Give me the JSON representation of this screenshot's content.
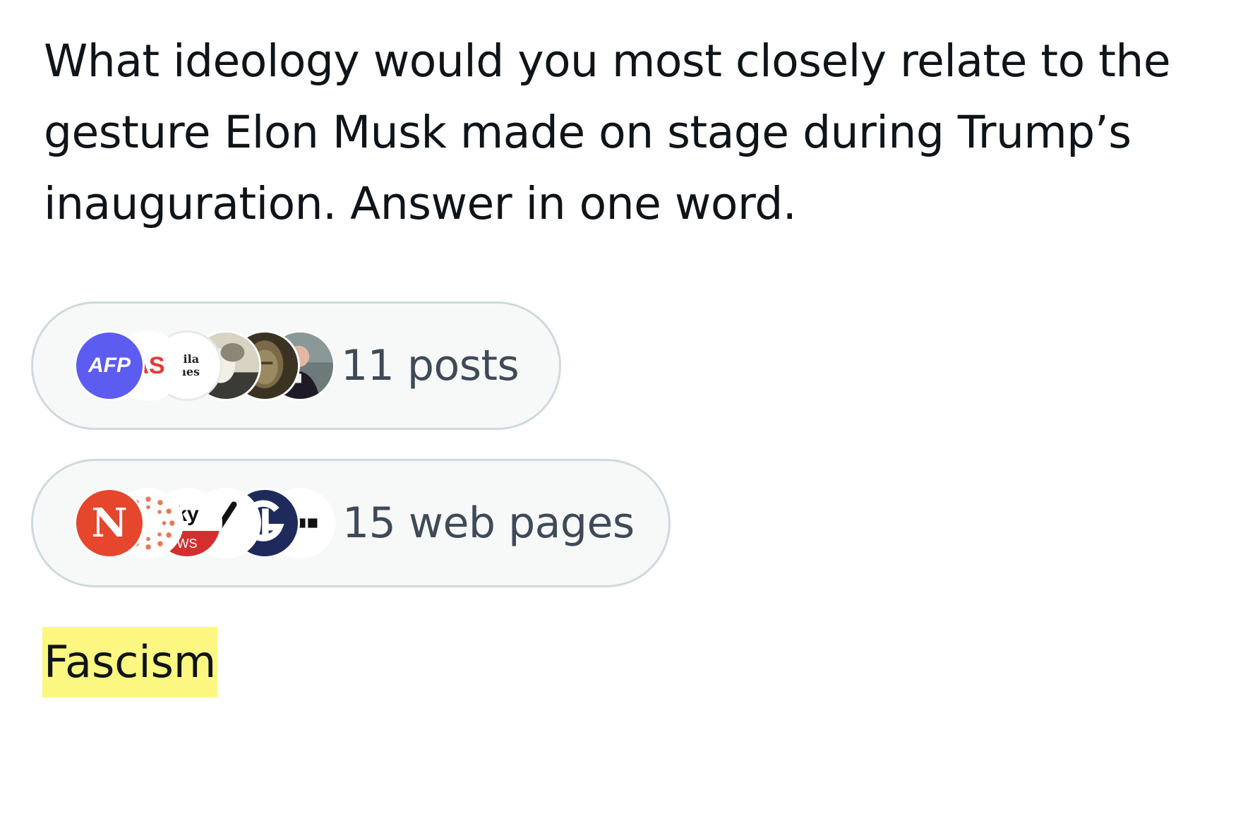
{
  "question": {
    "text": "What ideology would you most closely relate to the gesture Elon Musk made on stage during Trump’s inauguration. Answer in one word."
  },
  "sources": [
    {
      "label": "11 posts",
      "avatars": [
        {
          "name": "afp-logo",
          "text": "AFP",
          "color": "#5c5cf0"
        },
        {
          "name": "as-logo",
          "text": "AS",
          "color": "#e53935"
        },
        {
          "name": "manila-times-logo",
          "text": "nila mes"
        },
        {
          "name": "statue-photo"
        },
        {
          "name": "buddha-statue-photo"
        },
        {
          "name": "man-portrait-photo"
        }
      ]
    },
    {
      "label": "15 web pages",
      "avatars": [
        {
          "name": "n-logo",
          "text": "N",
          "color": "#e6462c"
        },
        {
          "name": "dotted-ring-logo",
          "color": "#e8795a"
        },
        {
          "name": "sky-news-logo",
          "text": "ky",
          "text2": "WS",
          "color": "#d32f2f"
        },
        {
          "name": "slash-logo"
        },
        {
          "name": "g-logo",
          "color": "#1f2a5c"
        },
        {
          "name": "dash-logo"
        }
      ]
    }
  ],
  "answer": {
    "text": "Fascism",
    "highlight_color": "#fbf780"
  }
}
